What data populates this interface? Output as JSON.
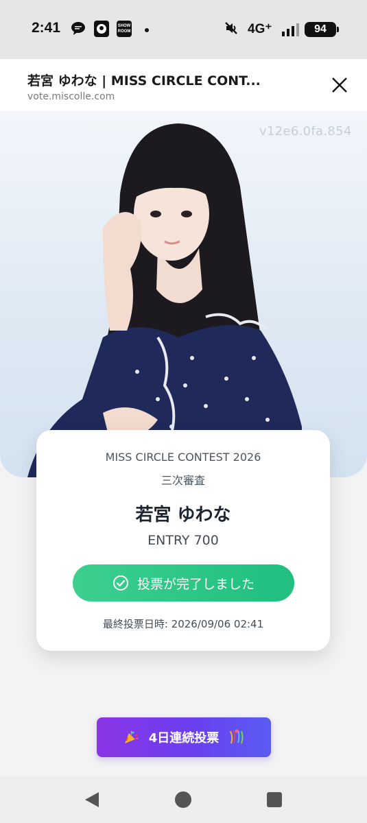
{
  "status_bar": {
    "time": "2:41",
    "network": "4G⁺",
    "battery": "94",
    "app_badge": "SHOW ROOM"
  },
  "browser": {
    "title": "若宮 ゆわな | MISS CIRCLE CONT...",
    "url": "vote.miscolle.com"
  },
  "hero": {
    "watermark": "v12e6.0fa.854"
  },
  "card": {
    "contest": "MISS CIRCLE CONTEST 2026",
    "stage": "三次審査",
    "name": "若宮 ゆわな",
    "entry": "ENTRY 700",
    "vote_button_label": "投票が完了しました",
    "last_vote": "最終投票日時: 2026/09/06 02:41"
  },
  "streak": {
    "label": "4日連続投票"
  },
  "colors": {
    "vote_button": "#2cc888",
    "streak_button_start": "#8b35e6",
    "streak_button_end": "#5a5cf2"
  }
}
